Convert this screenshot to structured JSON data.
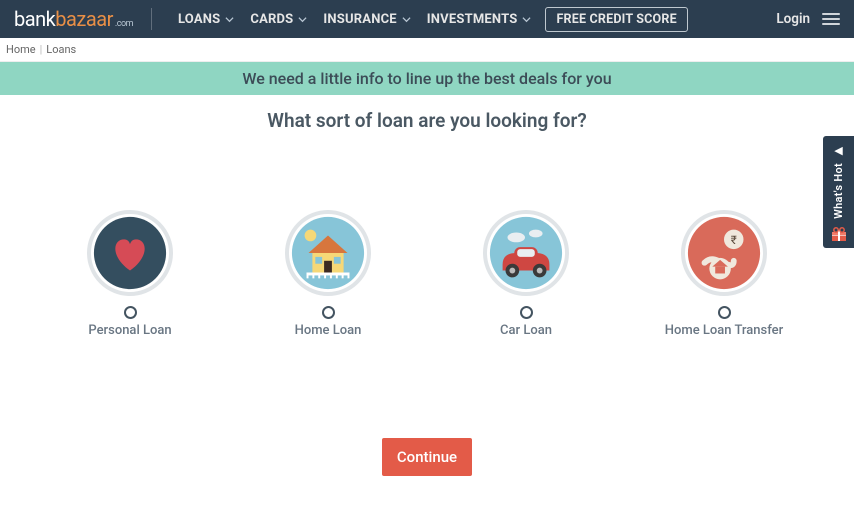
{
  "brand": {
    "part1": "bank",
    "part2": "bazaar",
    "suffix": ".com"
  },
  "nav": {
    "items": [
      {
        "label": "LOANS"
      },
      {
        "label": "CARDS"
      },
      {
        "label": "INSURANCE"
      },
      {
        "label": "INVESTMENTS"
      }
    ],
    "free_credit": "FREE CREDIT SCORE",
    "login": "Login"
  },
  "breadcrumb": {
    "home": "Home",
    "current": "Loans"
  },
  "banner": "We need a little info to line up the best deals for you",
  "question": "What sort of loan are you looking for?",
  "options": [
    {
      "label": "Personal Loan"
    },
    {
      "label": "Home Loan"
    },
    {
      "label": "Car Loan"
    },
    {
      "label": "Home Loan Transfer"
    }
  ],
  "continue": "Continue",
  "sidetab": "What's Hot",
  "colors": {
    "accent": "#e35b48",
    "header": "#2c3e50",
    "banner": "#8fd6c2"
  }
}
